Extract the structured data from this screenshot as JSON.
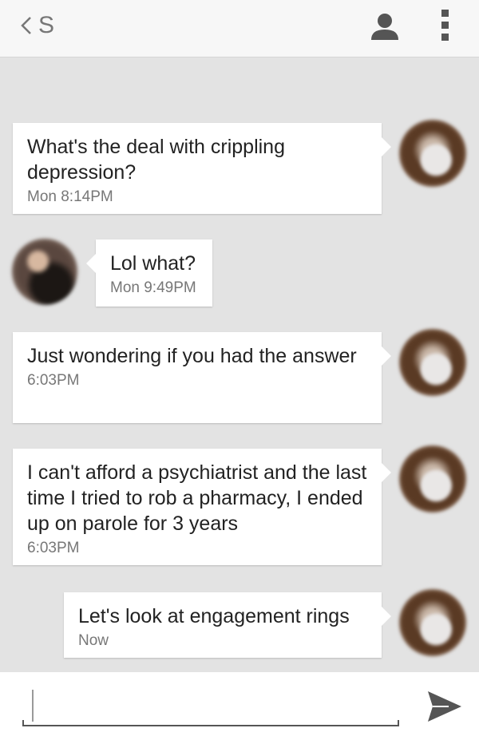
{
  "header": {
    "contact_initial": "S"
  },
  "messages": [
    {
      "text": "What's the deal with crippling depression?",
      "time": "Mon 8:14PM"
    },
    {
      "text": "Lol what?",
      "time": "Mon 9:49PM"
    },
    {
      "text": "Just wondering if you had the answer",
      "time": "6:03PM"
    },
    {
      "text": "I can't afford a psychiatrist and the last time I tried to rob a pharmacy, I ended up on parole for 3 years",
      "time": "6:03PM"
    },
    {
      "text": "Let's look at engagement rings",
      "time": "Now"
    }
  ],
  "composer": {
    "value": ""
  },
  "colors": {
    "background": "#e3e3e3",
    "bubble": "#ffffff",
    "header": "#f7f7f7",
    "icon": "#555555"
  }
}
